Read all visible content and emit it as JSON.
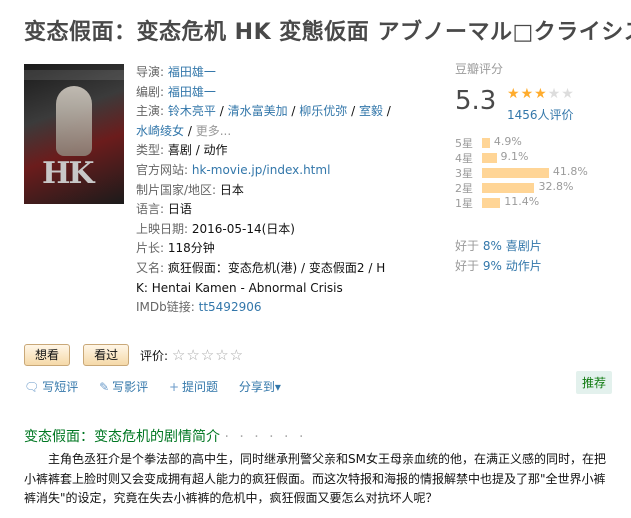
{
  "page": {
    "title": "变态假面：变态危机 HK 変態仮面 アブノーマル□クライシス"
  },
  "poster": {
    "alt": "HK poster",
    "hk_text": "HK"
  },
  "info": {
    "director_label": "导演:",
    "director": "福田雄一",
    "writer_label": "编剧:",
    "writer": "福田雄一",
    "cast_label": "主演:",
    "cast": [
      "铃木亮平",
      "清水富美加",
      "柳乐优弥",
      "室毅",
      "水崎绫女"
    ],
    "cast_more": "更多...",
    "genre_label": "类型:",
    "genre": "喜剧 / 动作",
    "site_label": "官方网站:",
    "site": "hk-movie.jp/index.html",
    "country_label": "制片国家/地区:",
    "country": "日本",
    "language_label": "语言:",
    "language": "日语",
    "release_label": "上映日期:",
    "release": "2016-05-14(日本)",
    "runtime_label": "片长:",
    "runtime": "118分钟",
    "aka_label": "又名:",
    "aka_line1": "疯狂假面：变态危机(港) / 变态假面2 / H",
    "aka_line2": "K: Hentai Kamen - Abnormal Crisis",
    "imdb_label": "IMDb链接:",
    "imdb": "tt5492906"
  },
  "rating": {
    "header": "豆瓣评分",
    "score": "5.3",
    "stars_filled": 3,
    "stars_total": 5,
    "count": "1456人评价",
    "star_color": "#ffac2d",
    "bar_color": "#ffd596",
    "distribution": [
      {
        "label": "5星",
        "percent": 4.9,
        "text": "4.9%"
      },
      {
        "label": "4星",
        "percent": 9.1,
        "text": "9.1%"
      },
      {
        "label": "3星",
        "percent": 41.8,
        "text": "41.8%"
      },
      {
        "label": "2星",
        "percent": 32.8,
        "text": "32.8%"
      },
      {
        "label": "1星",
        "percent": 11.4,
        "text": "11.4%"
      }
    ],
    "better_than": [
      {
        "prefix": "好于",
        "value": "8%",
        "genre": "喜剧片"
      },
      {
        "prefix": "好于",
        "value": "9%",
        "genre": "动作片"
      }
    ]
  },
  "buttons": {
    "want": "想看",
    "seen": "看过"
  },
  "user_rating": {
    "label": "评价:",
    "stars": "☆☆☆☆☆"
  },
  "actions": {
    "short_review": "写短评",
    "review": "写影评",
    "question": "提问题",
    "share": "分享到",
    "share_arrow": "▾",
    "recommend": "推荐"
  },
  "summary": {
    "title": "变态假面：变态危机的剧情简介",
    "dots": "· · · · · ·",
    "text": "主角色丞狂介是个拳法部的高中生，同时继承刑警父亲和SM女王母亲血统的他，在满正义感的同时，在把小裤裤套上脸时则又会变成拥有超人能力的疯狂假面。而这次特报和海报的情报解禁中也提及了那\"全世界小裤裤消失\"的设定，究竟在失去小裤裤的危机中，疯狂假面又要怎么对抗坏人呢？"
  }
}
